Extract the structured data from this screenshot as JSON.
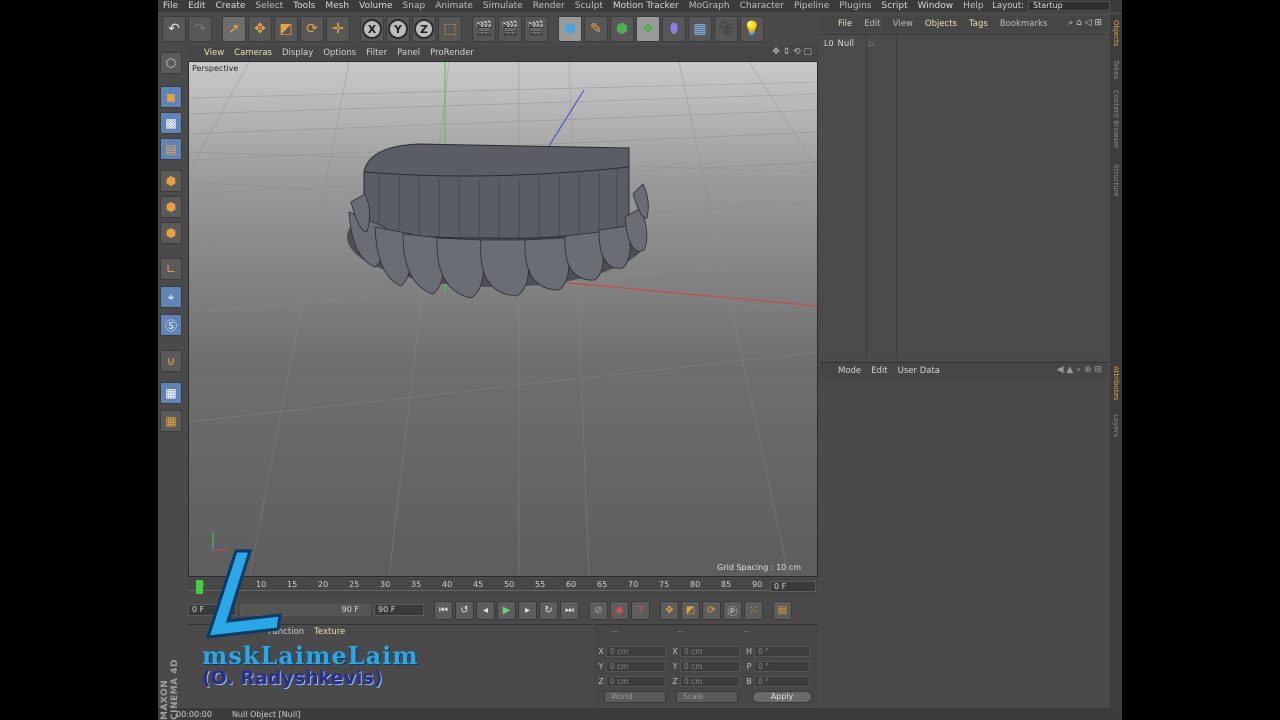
{
  "menubar": {
    "items": [
      "File",
      "Edit",
      "Create",
      "Select",
      "Tools",
      "Mesh",
      "Volume",
      "Snap",
      "Animate",
      "Simulate",
      "Render",
      "Sculpt",
      "Motion Tracker",
      "MoGraph",
      "Character",
      "Pipeline",
      "Plugins",
      "Script",
      "Window",
      "Help"
    ],
    "layout_label": "Layout:",
    "layout_value": "Startup"
  },
  "toolbar": {
    "axis_x": "X",
    "axis_y": "Y",
    "axis_z": "Z"
  },
  "viewport": {
    "menu": [
      "View",
      "Cameras",
      "Display",
      "Options",
      "Filter",
      "Panel",
      "ProRender"
    ],
    "label": "Perspective",
    "grid_spacing": "Grid Spacing : 10 cm"
  },
  "timeline": {
    "ticks": [
      "0",
      "10",
      "15",
      "20",
      "25",
      "30",
      "35",
      "40",
      "45",
      "50",
      "55",
      "60",
      "65",
      "70",
      "75",
      "80",
      "85",
      "90"
    ],
    "current_frame": "0 F",
    "start_frame": "0 F",
    "slider_end": "90 F",
    "end_frame": "90 F"
  },
  "object_manager": {
    "menu": [
      "File",
      "Edit",
      "View",
      "Objects",
      "Tags",
      "Bookmarks"
    ],
    "rows": [
      {
        "name": "Null"
      }
    ]
  },
  "attributes": {
    "menu": [
      "Mode",
      "Edit",
      "User Data"
    ]
  },
  "side_tabs": [
    "Objects",
    "Takes",
    "Content Browser",
    "Structure"
  ],
  "side_tabs_bottom": [
    "Attributes",
    "Layers"
  ],
  "material": {
    "menu": [
      "Function",
      "Texture"
    ]
  },
  "coordinates": {
    "header": [
      "--",
      "--",
      "--"
    ],
    "rows": [
      {
        "l1": "X",
        "v1": "0 cm",
        "l2": "X",
        "v2": "0 cm",
        "l3": "H",
        "v3": "0 °"
      },
      {
        "l1": "Y",
        "v1": "0 cm",
        "l2": "Y",
        "v2": "0 cm",
        "l3": "P",
        "v3": "0 °"
      },
      {
        "l1": "Z",
        "v1": "0 cm",
        "l2": "Z",
        "v2": "0 cm",
        "l3": "B",
        "v3": "0 °"
      }
    ],
    "mode": "World",
    "scale": "Scale",
    "apply": "Apply"
  },
  "status": {
    "time": "00:00:00",
    "message": "Null Object [Null]"
  },
  "brand": "MAXON CINEMA 4D",
  "watermark": {
    "line1": "mskLaimeLaim",
    "line2": "(O. Radyshkevis)"
  },
  "colors": {
    "accent": "#e6a23c",
    "panel": "#4a4a4a",
    "watermark": "#2aa7e6"
  }
}
